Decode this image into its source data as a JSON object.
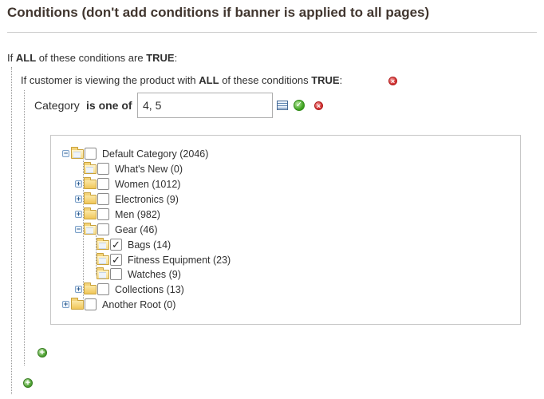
{
  "title": "Conditions (don't add conditions if banner is applied to all pages)",
  "rule_root": {
    "prefix": "If",
    "aggregator": "ALL",
    "middle": "of these conditions are",
    "value": "TRUE",
    "suffix": ":"
  },
  "rule_product": {
    "prefix": "If customer is viewing the product with",
    "aggregator": "ALL",
    "middle": "of these conditions",
    "value": "TRUE",
    "suffix": ":"
  },
  "category_condition": {
    "attribute": "Category",
    "operator": "is one of",
    "value": "4, 5"
  },
  "tree": [
    {
      "label": "Default Category (2046)",
      "checked": false,
      "toggle": "minus"
    },
    {
      "label": "What's New (0)",
      "checked": false,
      "toggle": "none"
    },
    {
      "label": "Women (1012)",
      "checked": false,
      "toggle": "plus"
    },
    {
      "label": "Electronics (9)",
      "checked": false,
      "toggle": "plus"
    },
    {
      "label": "Men (982)",
      "checked": false,
      "toggle": "plus"
    },
    {
      "label": "Gear (46)",
      "checked": false,
      "toggle": "minus"
    },
    {
      "label": "Bags (14)",
      "checked": true,
      "toggle": "none"
    },
    {
      "label": "Fitness Equipment (23)",
      "checked": true,
      "toggle": "none"
    },
    {
      "label": "Watches (9)",
      "checked": false,
      "toggle": "none"
    },
    {
      "label": "Collections (13)",
      "checked": false,
      "toggle": "plus"
    },
    {
      "label": "Another Root (0)",
      "checked": false,
      "toggle": "plus"
    }
  ],
  "icons": {
    "remove": "remove-icon",
    "apply": "apply-icon",
    "chooser": "chooser-icon",
    "add": "add-icon",
    "folder": "folder-icon"
  }
}
